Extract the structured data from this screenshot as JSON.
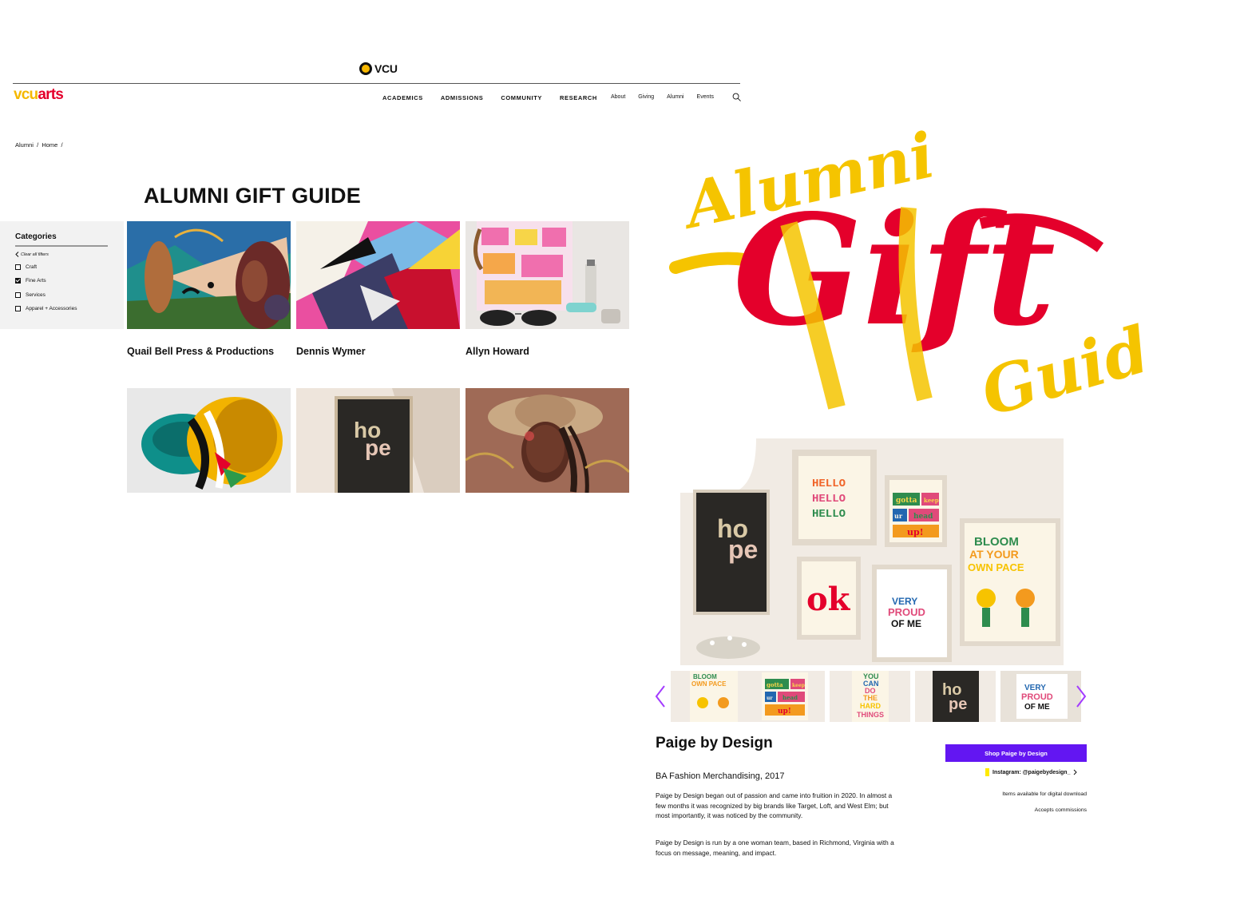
{
  "site": {
    "vcu_wordmark": "VCU",
    "logo_vcu": "vcu",
    "logo_arts": "arts",
    "brand_colors": {
      "gold": "#f5b800",
      "red": "#e4002b",
      "purple": "#6316f2"
    }
  },
  "nav": {
    "main": [
      "ACADEMICS",
      "ADMISSIONS",
      "COMMUNITY",
      "RESEARCH"
    ],
    "secondary": [
      "About",
      "Giving",
      "Alumni",
      "Events"
    ],
    "search_icon": "search-icon"
  },
  "breadcrumb": "Alumni  /  Home  /",
  "page": {
    "title": "ALUMNI GIFT GUIDE"
  },
  "sidebar": {
    "heading": "Categories",
    "clear_label": "Clear all filters",
    "categories": [
      {
        "label": "Craft",
        "checked": false
      },
      {
        "label": "Fine Arts",
        "checked": true
      },
      {
        "label": "Services",
        "checked": false
      },
      {
        "label": "Apparel + Accessories",
        "checked": false
      }
    ]
  },
  "grid": {
    "cards": [
      {
        "title": "Quail Bell Press & Productions"
      },
      {
        "title": "Dennis Wymer"
      },
      {
        "title": "Allyn Howard"
      },
      {
        "title": ""
      },
      {
        "title": ""
      },
      {
        "title": ""
      }
    ]
  },
  "hero": {
    "line1": "Alumni",
    "line2": "Gift",
    "line3": "Guide"
  },
  "prints": {
    "hello": "HELLO",
    "hope_a": "ho",
    "hope_b": "pe",
    "gotta": "gotta",
    "keep": "keep",
    "your": "ur",
    "head": "head",
    "up": "up!",
    "ok": "ok",
    "proud": [
      "VERY",
      "PROUD",
      "OF ME"
    ],
    "bloom": [
      "BLOOM",
      "AT YOUR",
      "OWN PACE"
    ],
    "hard": [
      "YOU",
      "CAN",
      "DO",
      "THE",
      "HARD",
      "THINGS"
    ]
  },
  "detail": {
    "name": "Paige by Design",
    "degree": "BA Fashion Merchandising, 2017",
    "paragraph1": "Paige by Design began out of passion and came into fruition in 2020. In almost a few months it was recognized by big brands like Target, Loft, and West Elm; but most importantly, it was noticed by the community.",
    "paragraph2": "Paige by Design is run by a one woman team, based in Richmond, Virginia with a focus on message, meaning, and impact.",
    "shop_button": "Shop Paige by Design",
    "instagram": "Instagram: @paigebydesign_",
    "note1": "Items available for digital download",
    "note2": "Accepts commissions"
  }
}
